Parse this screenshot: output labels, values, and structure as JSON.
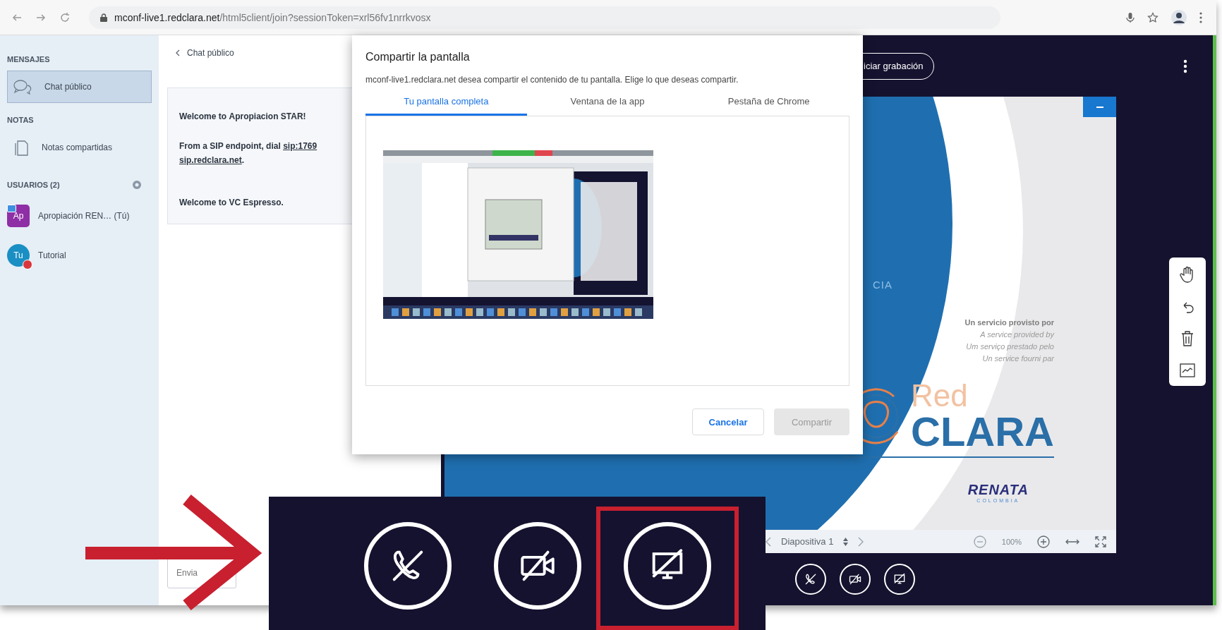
{
  "browser": {
    "url_host": "mconf-live1.redclara.net",
    "url_path": "/html5client/join?sessionToken=xrl56fv1nrrkvosx"
  },
  "messages_section": {
    "title": "MENSAJES",
    "items": [
      {
        "label": "Chat público",
        "selected": true
      }
    ]
  },
  "notes_section": {
    "title": "NOTAS",
    "items": [
      {
        "label": "Notas compartidas",
        "selected": false
      }
    ]
  },
  "users_section": {
    "title": "USUARIOS (2)",
    "users": [
      {
        "initials": "Ap",
        "name": "Apropiación REN… (Tú)",
        "color": "#8e2fa6",
        "presenter": true,
        "muted": false
      },
      {
        "initials": "Tu",
        "name": "Tutorial",
        "color": "#1a8fc4",
        "presenter": false,
        "muted": true
      }
    ]
  },
  "chat": {
    "back_label": "Chat público",
    "messages": [
      {
        "kind": "text",
        "text": "Welcome to **Apropiacion STAR**!"
      },
      {
        "kind": "sip",
        "prefix": "From a SIP endpoint, dial ",
        "link": "sip:1769",
        "link_2": "sip.redclara.net",
        "suffix": "."
      },
      {
        "kind": "text",
        "text": "Welcome to VC Espresso."
      }
    ],
    "input": {
      "placeholder": "Envia"
    }
  },
  "topbar": {
    "record_button": "iciar grabación"
  },
  "slide": {
    "fragment": "CIA",
    "provider_lines": [
      "Un servicio provisto por",
      "A service provided by",
      "Um serviço prestado pelo",
      "Un service fourni par"
    ],
    "logo_word_1": "Red",
    "logo_word_2": "CLARA",
    "partner_logo": "RENATA",
    "partner_sub": "COLOMBIA",
    "footer": {
      "slide_label": "Diapositiva 1",
      "zoom": "100%"
    }
  },
  "action_bar": {
    "buttons": [
      {
        "kind": "audio"
      },
      {
        "kind": "video"
      },
      {
        "kind": "screen"
      }
    ]
  },
  "dialog": {
    "title": "Compartir la pantalla",
    "description": "mconf-live1.redclara.net desea compartir el contenido de tu pantalla. Elige lo que deseas compartir.",
    "tabs": [
      {
        "label": "Tu pantalla completa",
        "selected": true
      },
      {
        "label": "Ventana de la app",
        "selected": false
      },
      {
        "label": "Pestaña de Chrome",
        "selected": false
      }
    ],
    "buttons": [
      {
        "label": "Cancelar",
        "kind": "secondary",
        "disabled": false
      },
      {
        "label": "Compartir",
        "kind": "primary",
        "disabled": true
      }
    ]
  },
  "callout": {
    "buttons": [
      {
        "kind": "audio",
        "highlighted": false
      },
      {
        "kind": "video",
        "highlighted": false
      },
      {
        "kind": "screen",
        "highlighted": true
      }
    ]
  }
}
